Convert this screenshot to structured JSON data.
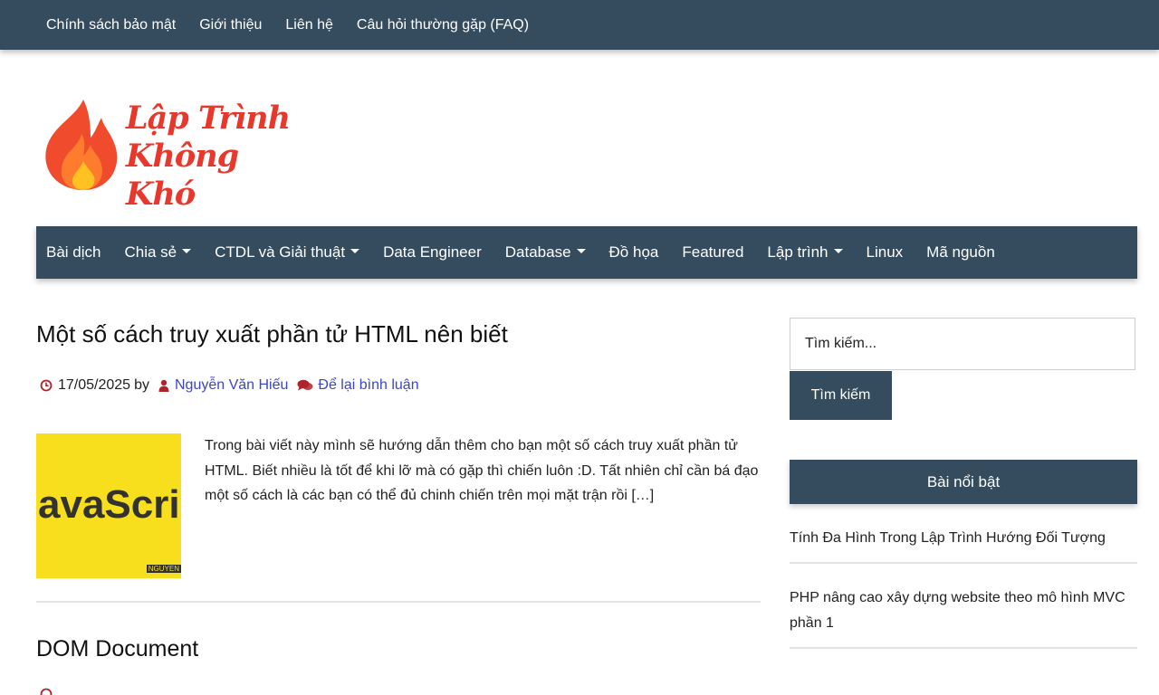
{
  "topnav": {
    "items": [
      {
        "label": "Chính sách bảo mật"
      },
      {
        "label": "Giới thiệu"
      },
      {
        "label": "Liên hệ"
      },
      {
        "label": "Câu hỏi thường gặp (FAQ)"
      }
    ]
  },
  "logo": {
    "line1": "Lập Trình",
    "line2": "Không Khó"
  },
  "mainnav": {
    "items": [
      {
        "label": "Bài dịch",
        "dropdown": false
      },
      {
        "label": "Chia sẻ",
        "dropdown": true
      },
      {
        "label": "CTDL và Giải thuật",
        "dropdown": true
      },
      {
        "label": "Data Engineer",
        "dropdown": false
      },
      {
        "label": "Database",
        "dropdown": true
      },
      {
        "label": "Đồ họa",
        "dropdown": false
      },
      {
        "label": "Featured",
        "dropdown": false
      },
      {
        "label": "Lập trình",
        "dropdown": true
      },
      {
        "label": "Linux",
        "dropdown": false
      },
      {
        "label": "Mã nguồn",
        "dropdown": false
      }
    ]
  },
  "post": {
    "title": "Một số cách truy xuất phần tử HTML nên biết",
    "date": "17/05/2025",
    "by": "by",
    "author": "Nguyễn Văn Hiếu",
    "comment_link": "Để lại bình luận",
    "thumbnail_text": "avaScrip",
    "thumbnail_mark": "NGUYEN",
    "excerpt": "Trong bài viết này mình sẽ hướng dẫn thêm cho bạn một số cách truy xuất phần tử HTML. Biết nhiều là tốt để khi lỡ mà có gặp thì chiến luôn :D. Tất nhiên chỉ cần bá đạo một số cách là các bạn có thể đủ chinh chiến trên mọi mặt trận rồi […]"
  },
  "post2": {
    "title": "DOM Document"
  },
  "sidebar": {
    "search_placeholder": "Tìm kiếm...",
    "search_button": "Tìm kiếm",
    "featured_title": "Bài nổi bật",
    "featured_items": [
      {
        "label": "Tính Đa Hình Trong Lập Trình Hướng Đối Tượng"
      },
      {
        "label": "PHP nâng cao xây dựng website theo mô hình MVC phần 1"
      }
    ]
  },
  "colors": {
    "nav_bg": "#354b5e",
    "accent_red": "#e8372b",
    "link_blue": "#3b46c9"
  }
}
